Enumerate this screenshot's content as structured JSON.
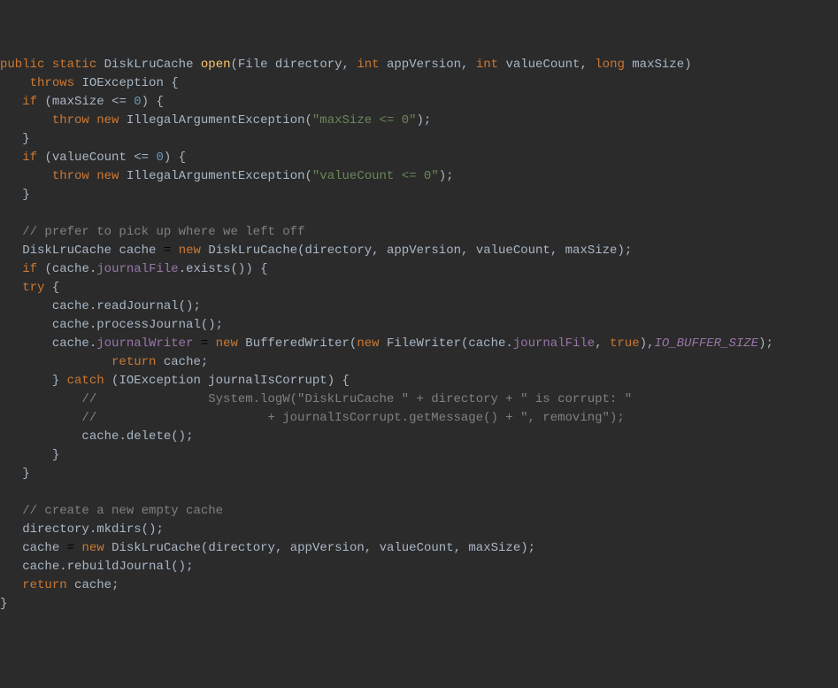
{
  "code": {
    "method_decl": {
      "mod1": "public",
      "mod2": "static",
      "ret_type": "DiskLruCache",
      "name": "open",
      "p1_type": "File",
      "p1_name": "directory",
      "p2_type": "int",
      "p2_name": "appVersion",
      "p3_type": "int",
      "p3_name": "valueCount",
      "p4_type": "long",
      "p4_name": "maxSize"
    },
    "throws_kw": "throws",
    "ioexception": "IOException",
    "if_kw": "if",
    "maxsize_cond": "maxSize <= ",
    "zero": "0",
    "throw_kw": "throw",
    "new_kw": "new",
    "iae": "IllegalArgumentException",
    "str_maxsize": "\"maxSize <= 0\"",
    "valuecount_cond": "valueCount <= ",
    "str_valuecount": "\"valueCount <= 0\"",
    "cmt1": "// prefer to pick up where we left off",
    "dlc": "DiskLruCache",
    "cache_var": "cache",
    "directory": "directory",
    "appversion": "appVersion",
    "valuecount": "valueCount",
    "maxsize": "maxSize",
    "journalfile": "journalFile",
    "exists": "exists",
    "try_kw": "try",
    "readjournal": "readJournal",
    "processjournal": "processJournal",
    "journalwriter": "journalWriter",
    "bufferedwriter": "BufferedWriter",
    "filewriter": "FileWriter",
    "true_kw": "true",
    "io_buffer_size": "IO_BUFFER_SIZE",
    "return_kw": "return",
    "catch_kw": "catch",
    "journal_corrupt": "journalIsCorrupt",
    "cmt2": "//               System.logW(\"DiskLruCache \" + directory + \" is corrupt: \"",
    "cmt3": "//                       + journalIsCorrupt.getMessage() + \", removing\");",
    "delete": "delete",
    "cmt4": "// create a new empty cache",
    "mkdirs": "mkdirs",
    "rebuildjournal": "rebuildJournal"
  }
}
